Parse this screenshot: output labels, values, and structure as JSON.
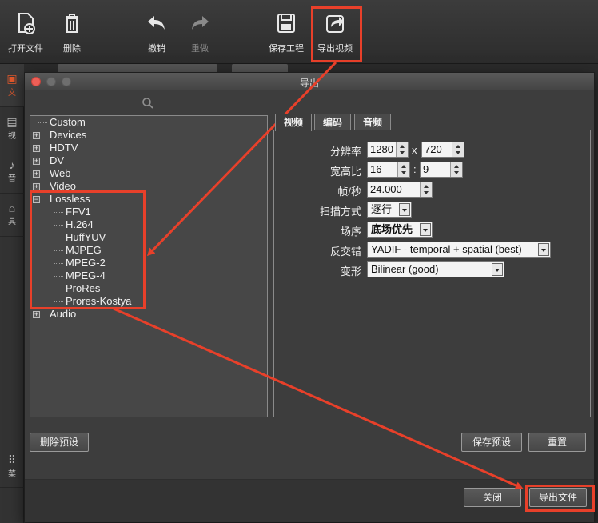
{
  "toolbar": {
    "open_file": "打开文件",
    "delete": "删除",
    "undo": "撤销",
    "redo": "重做",
    "save_project": "保存工程",
    "export_video": "导出视频"
  },
  "left_strip": {
    "item1": "文",
    "item2": "视",
    "item3": "音",
    "item4": "具",
    "item5": "菜"
  },
  "dialog": {
    "title": "导出",
    "tree": {
      "custom": "Custom",
      "devices": "Devices",
      "hdtv": "HDTV",
      "dv": "DV",
      "web": "Web",
      "video": "Video",
      "lossless": "Lossless",
      "lossless_children": [
        "FFV1",
        "H.264",
        "HuffYUV",
        "MJPEG",
        "MPEG-2",
        "MPEG-4",
        "ProRes",
        "Prores-Kostya"
      ],
      "audio": "Audio"
    },
    "tabs": [
      "视频",
      "编码",
      "音频"
    ],
    "form": {
      "resolution_label": "分辨率",
      "resolution_w": "1280",
      "resolution_sep": "x",
      "resolution_h": "720",
      "aspect_label": "宽高比",
      "aspect_w": "16",
      "aspect_sep": ":",
      "aspect_h": "9",
      "fps_label": "帧/秒",
      "fps_value": "24.000",
      "scan_label": "扫描方式",
      "scan_value": "逐行",
      "field_label": "场序",
      "field_value": "底场优先",
      "deinterlace_label": "反交错",
      "deinterlace_value": "YADIF - temporal + spatial (best)",
      "transform_label": "变形",
      "transform_value": "Bilinear (good)"
    },
    "buttons": {
      "delete_preset": "删除预设",
      "save_preset": "保存预设",
      "reset": "重置",
      "close": "关闭",
      "export_file": "导出文件"
    }
  },
  "colors": {
    "annotation": "#e8402a",
    "close_dot": "#ee5f57"
  }
}
